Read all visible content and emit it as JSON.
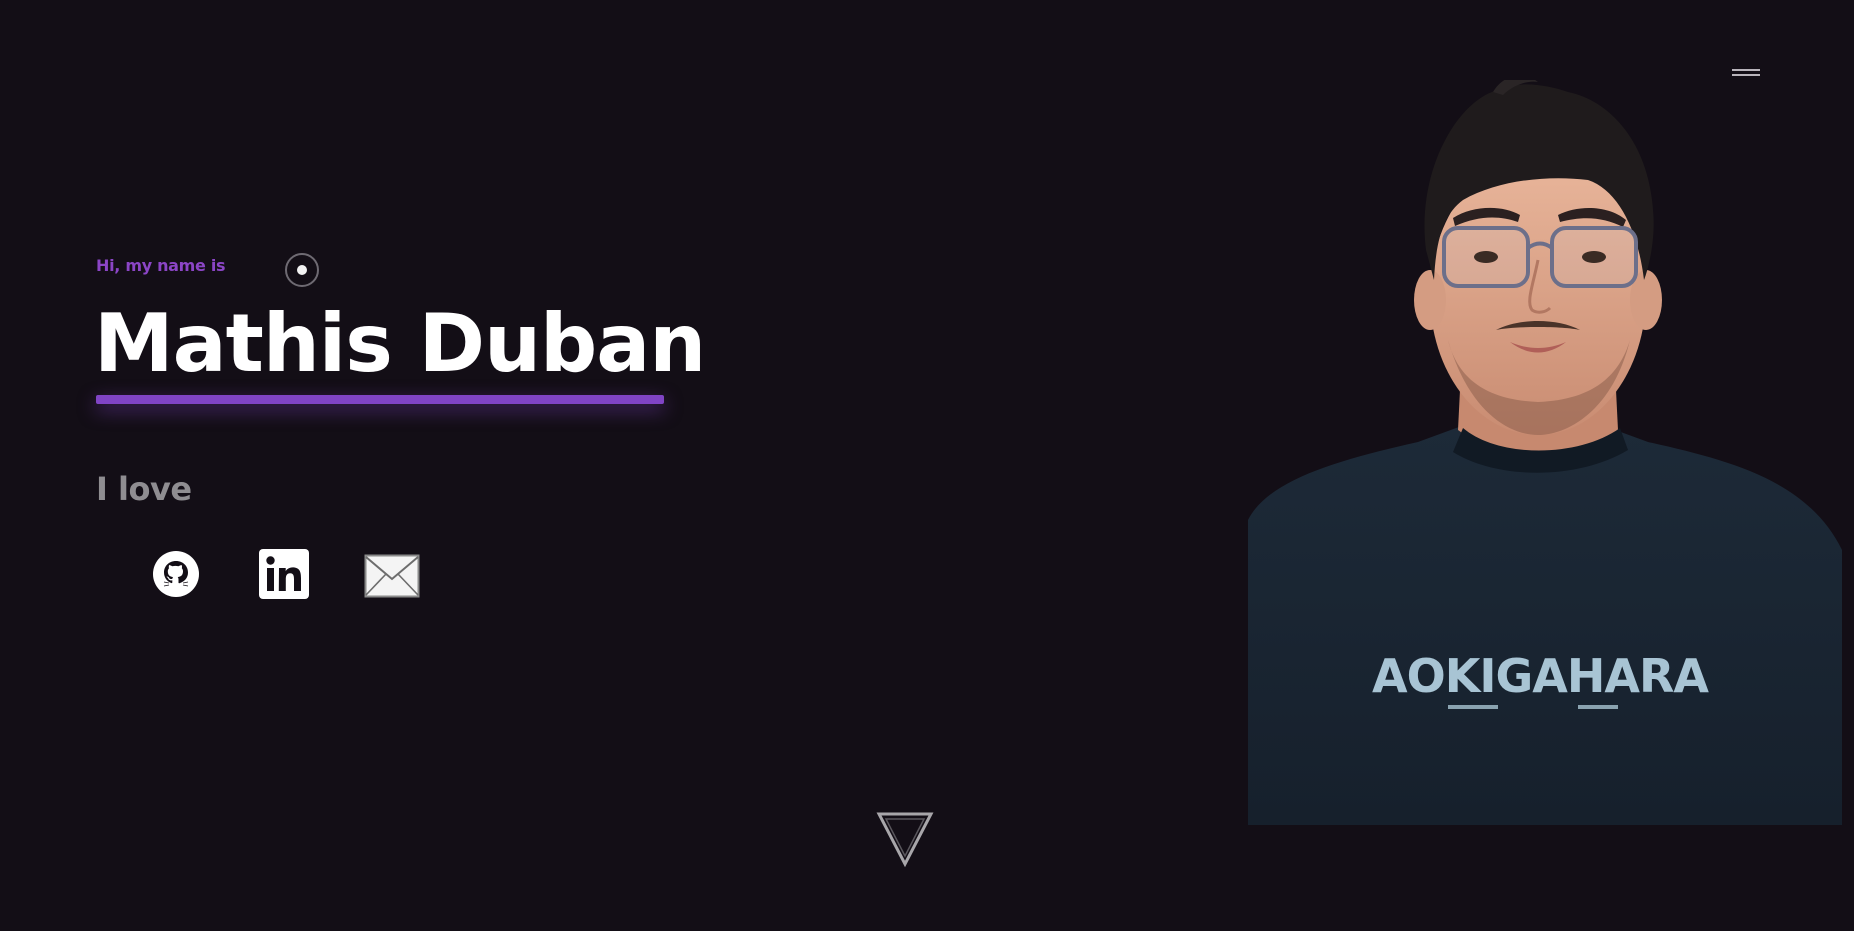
{
  "header": {
    "menu_icon": "hamburger-menu-icon"
  },
  "hero": {
    "greeting": "Hi, my name is",
    "name": "Mathis Duban",
    "love_text": "I love"
  },
  "social": [
    {
      "icon": "github-icon"
    },
    {
      "icon": "linkedin-icon"
    },
    {
      "icon": "email-icon"
    }
  ],
  "scroll_icon": "down-triangle-icon",
  "portrait": {
    "shirt_text": "AOKIGAHARA"
  },
  "colors": {
    "background": "#130e16",
    "accent": "#8044c5",
    "greeting": "#8b45c6",
    "muted_text": "#8f8d91"
  }
}
